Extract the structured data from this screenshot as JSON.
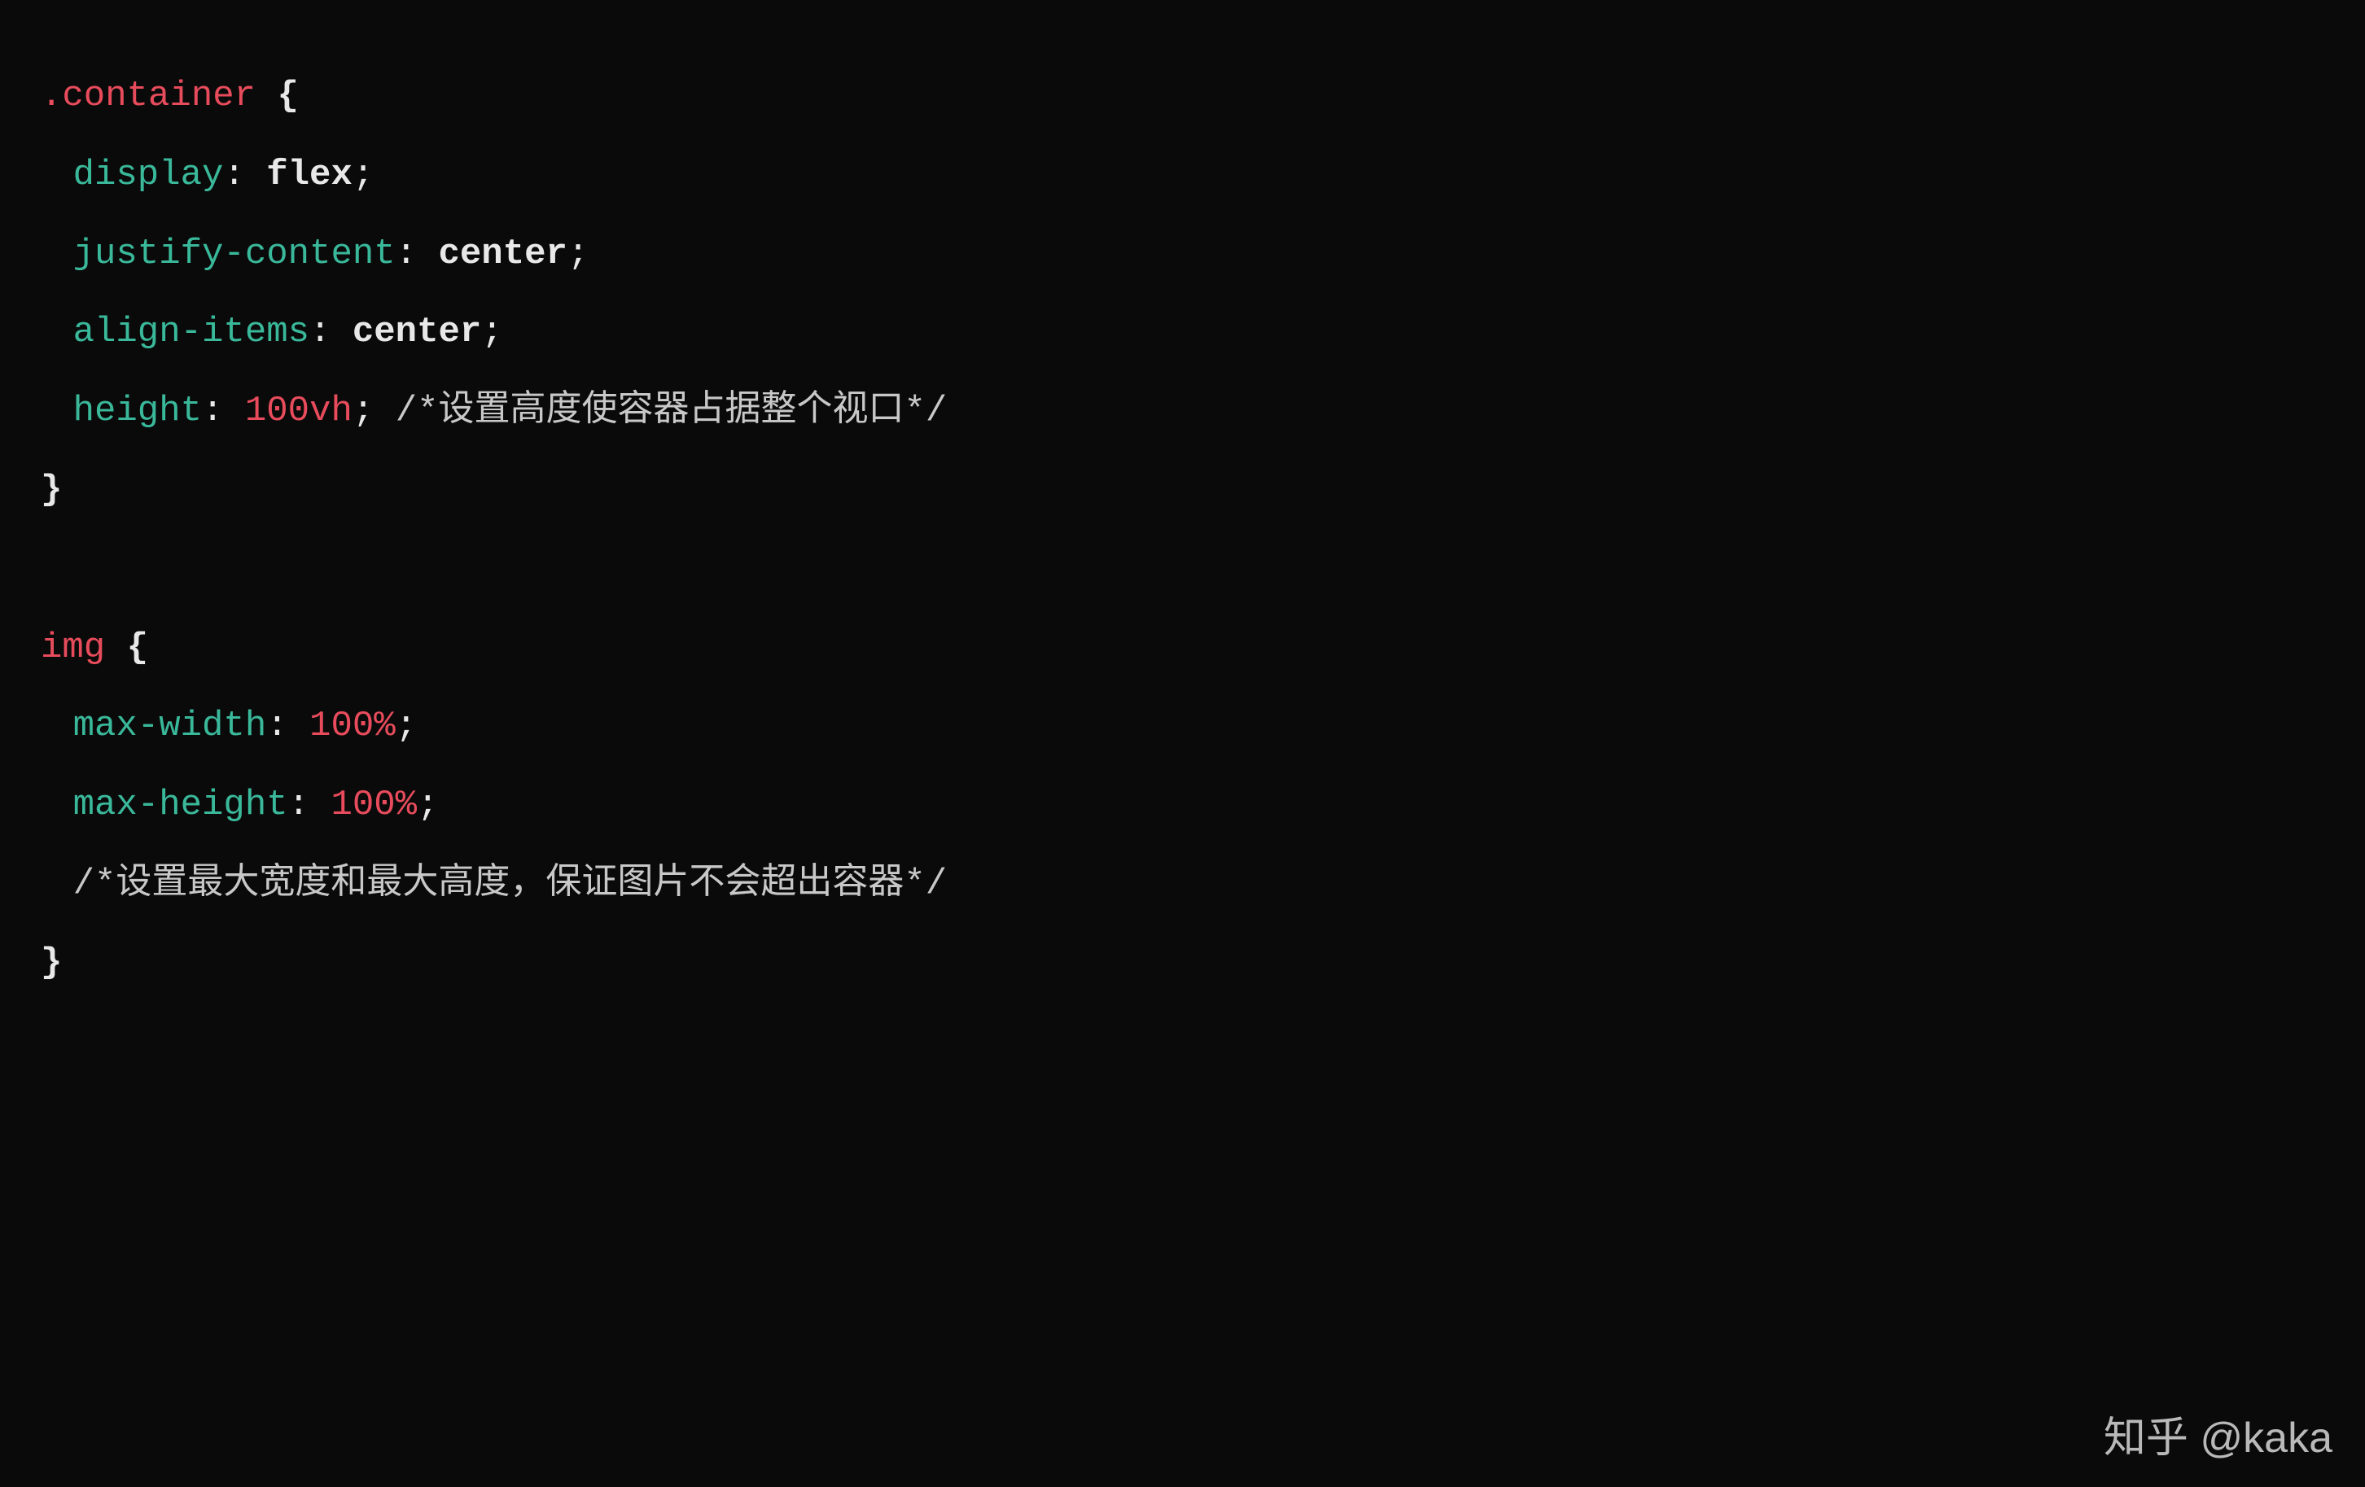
{
  "code": {
    "rule1": {
      "selectorDot": ".",
      "selectorName": "container",
      "openBrace": " {",
      "props": {
        "display": {
          "name": "display",
          "value": "flex"
        },
        "justify": {
          "name": "justify-content",
          "value": "center"
        },
        "align": {
          "name": "align-items",
          "value": "center"
        },
        "height": {
          "name": "height",
          "valueNum": "100",
          "valueUnit": "vh",
          "comment": "/*设置高度使容器占据整个视口*/"
        }
      },
      "closeBrace": "}"
    },
    "rule2": {
      "selector": "img",
      "openBrace": " {",
      "props": {
        "maxw": {
          "name": "max-width",
          "valueNum": "100%"
        },
        "maxh": {
          "name": "max-height",
          "valueNum": "100%"
        },
        "comment": "/*设置最大宽度和最大高度，保证图片不会超出容器*/"
      },
      "closeBrace": "}"
    }
  },
  "punct": {
    "colon": ": ",
    "semi": ";"
  },
  "watermark": "知乎 @kaka"
}
